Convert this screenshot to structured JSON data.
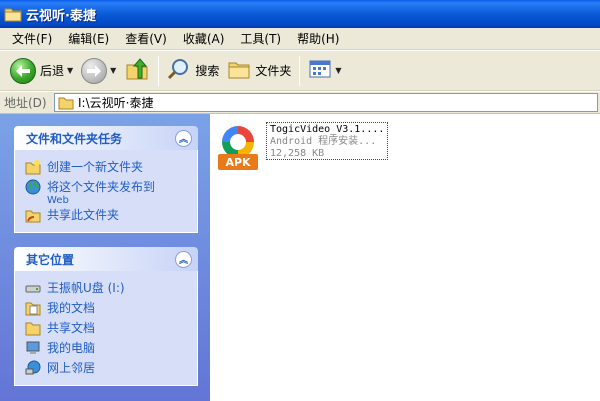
{
  "window": {
    "title": "云视听·泰捷"
  },
  "menu": {
    "items": [
      "文件(F)",
      "编辑(E)",
      "查看(V)",
      "收藏(A)",
      "工具(T)",
      "帮助(H)"
    ]
  },
  "toolbar": {
    "back_label": "后退",
    "search_label": "搜索",
    "folders_label": "文件夹"
  },
  "address": {
    "label": "地址(D)",
    "path": "I:\\云视听·泰捷"
  },
  "tasks_panel": {
    "title": "文件和文件夹任务",
    "items": [
      {
        "label": "创建一个新文件夹",
        "sub": ""
      },
      {
        "label": "将这个文件夹发布到",
        "sub": "Web"
      },
      {
        "label": "共享此文件夹",
        "sub": ""
      }
    ]
  },
  "places_panel": {
    "title": "其它位置",
    "items": [
      "王振帆U盘 (I:)",
      "我的文档",
      "共享文档",
      "我的电脑",
      "网上邻居"
    ]
  },
  "files": [
    {
      "name": "TogicVideo_V3.1....",
      "type": "Android 程序安装...",
      "size": "12,258 KB",
      "badge": "APK"
    }
  ],
  "colors": {
    "titlebar": "#0a5ad6",
    "taskpane": "#6b8be0",
    "link": "#215dc6",
    "apk_badge": "#e87a1a"
  }
}
